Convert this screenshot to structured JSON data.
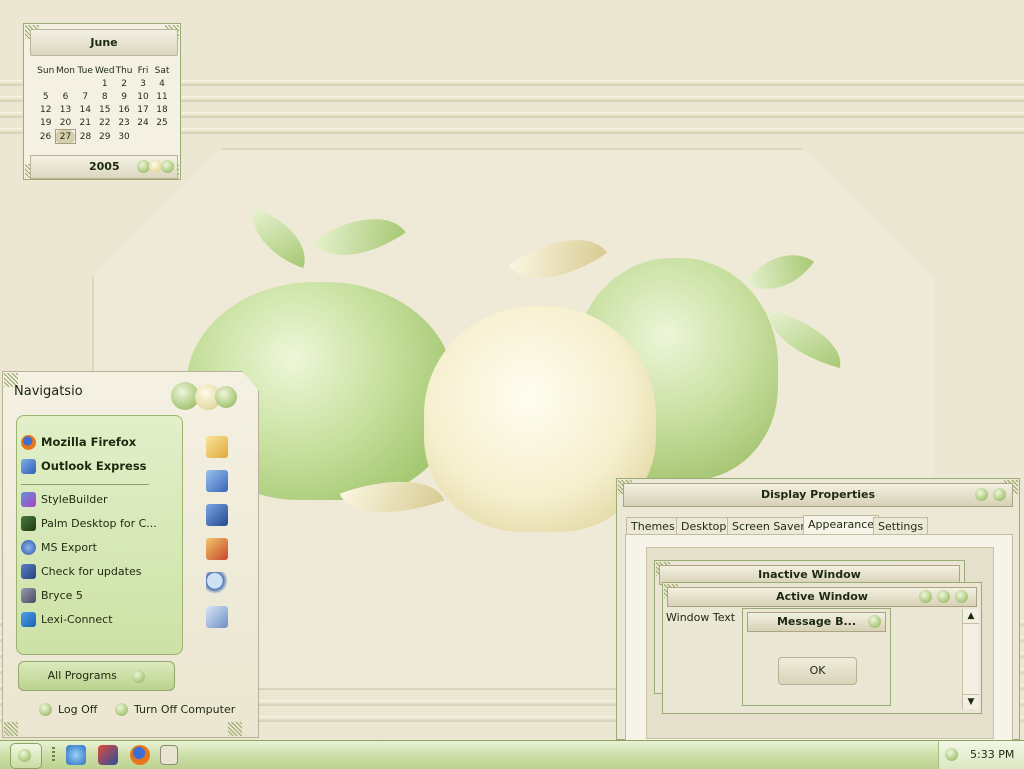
{
  "calendar": {
    "month": "June",
    "year": "2005",
    "weekdays": [
      "Sun",
      "Mon",
      "Tue",
      "Wed",
      "Thu",
      "Fri",
      "Sat"
    ],
    "weeks": [
      [
        "",
        "",
        "",
        "1",
        "2",
        "3",
        "4"
      ],
      [
        "5",
        "6",
        "7",
        "8",
        "9",
        "10",
        "11"
      ],
      [
        "12",
        "13",
        "14",
        "15",
        "16",
        "17",
        "18"
      ],
      [
        "19",
        "20",
        "21",
        "22",
        "23",
        "24",
        "25"
      ],
      [
        "26",
        "27",
        "28",
        "29",
        "30",
        "",
        ""
      ]
    ],
    "today": "27"
  },
  "start_menu": {
    "title": "Navigatsio",
    "pinned": [
      {
        "label": "Mozilla Firefox",
        "icon": "firefox-icon"
      },
      {
        "label": "Outlook Express",
        "icon": "outlook-express-icon"
      }
    ],
    "recent": [
      {
        "label": "StyleBuilder",
        "icon": "stylebuilder-icon"
      },
      {
        "label": "Palm Desktop for C...",
        "icon": "palm-desktop-icon"
      },
      {
        "label": "MS Export",
        "icon": "ms-export-icon"
      },
      {
        "label": "Check for updates",
        "icon": "updates-icon"
      },
      {
        "label": "Bryce 5",
        "icon": "bryce-icon"
      },
      {
        "label": "Lexi-Connect",
        "icon": "lexi-connect-icon"
      }
    ],
    "all_programs": "All Programs",
    "log_off": "Log Off",
    "turn_off": "Turn Off Computer",
    "right_icons": [
      "documents-icon",
      "computer-icon",
      "control-panel-icon",
      "programs-icon",
      "search-icon",
      "run-icon"
    ]
  },
  "display_properties": {
    "title": "Display Properties",
    "tabs": [
      "Themes",
      "Desktop",
      "Screen Saver",
      "Appearance",
      "Settings"
    ],
    "selected_tab": "Appearance",
    "preview": {
      "inactive_title": "Inactive Window",
      "active_title": "Active Window",
      "window_text": "Window Text",
      "message_title": "Message B...",
      "ok_label": "OK"
    }
  },
  "taskbar": {
    "clock": "5:33 PM",
    "quick_launch": [
      "internet-explorer-icon",
      "media-icon",
      "firefox-icon",
      "desktop-icon"
    ]
  },
  "colors": {
    "accent_green": "#b9d08c",
    "cream": "#ece7d3",
    "border_green": "#9aac74"
  }
}
